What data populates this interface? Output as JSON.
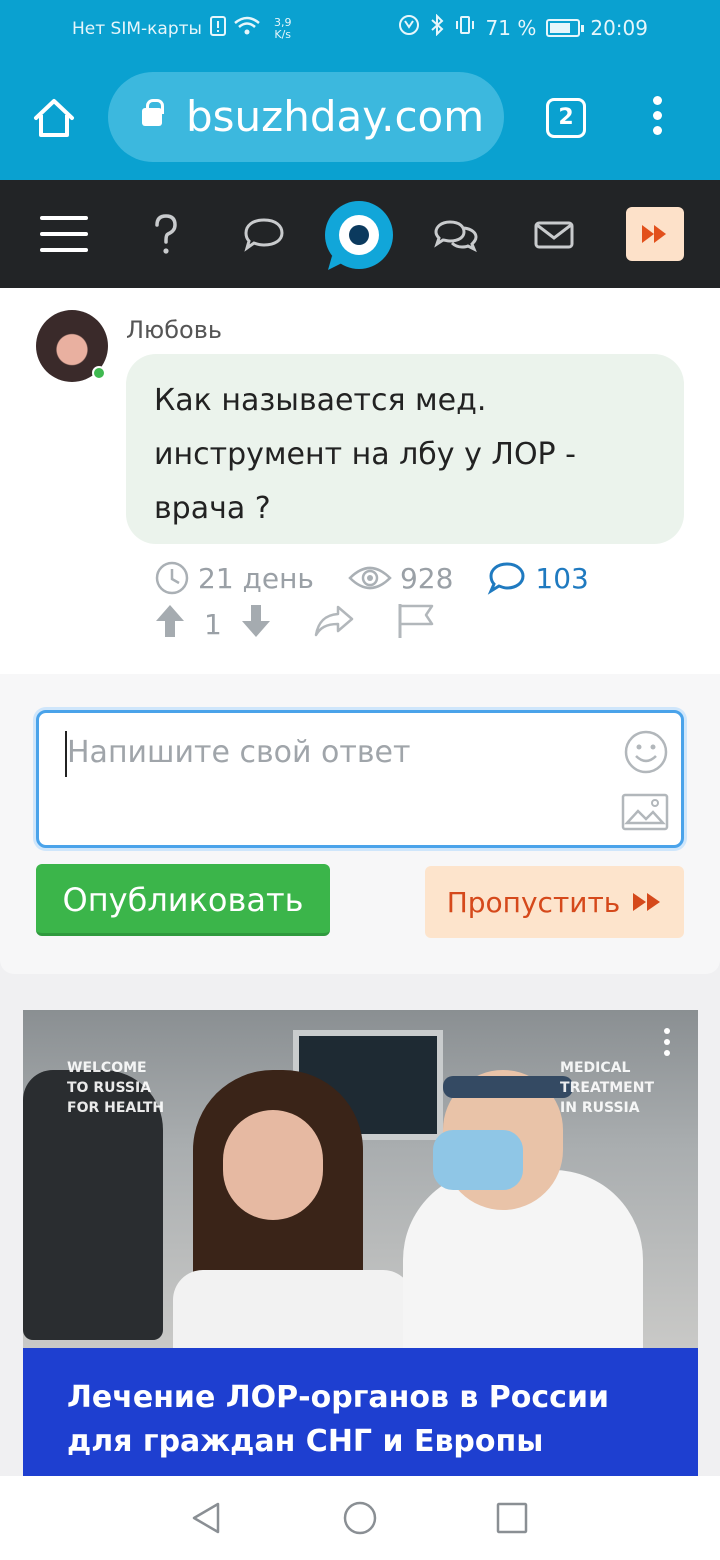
{
  "status_bar": {
    "carrier": "Нет SIM-карты",
    "speed_value": "3,9",
    "speed_unit": "K/s",
    "battery": "71 %",
    "time": "20:09"
  },
  "browser": {
    "url": "bsuzhday.com",
    "tab_count": "2"
  },
  "question": {
    "author": "Любовь",
    "text": "Как называется мед. инструмент на лбу у ЛОР - врача ?",
    "age": "21 день",
    "views": "928",
    "comments": "103",
    "votes": "1"
  },
  "answer": {
    "placeholder": "Напишите свой ответ",
    "publish_label": "Опубликовать",
    "skip_label": "Пропустить"
  },
  "ad": {
    "label_left_1": "WELCOME",
    "label_left_2": "TO RUSSIA",
    "label_left_3": "FOR HEALTH",
    "label_right_1": "MEDICAL",
    "label_right_2": "TREATMENT",
    "label_right_3": "IN RUSSIA",
    "headline_1": "Лечение ЛОР-органов в России",
    "headline_2": "для граждан СНГ и Европы"
  },
  "colors": {
    "browser_blue": "#0aa1d0",
    "nav_dark": "#222426",
    "publish_green": "#3bb54a",
    "skip_orange": "#d5491b",
    "comments_blue": "#1f7ac0"
  }
}
